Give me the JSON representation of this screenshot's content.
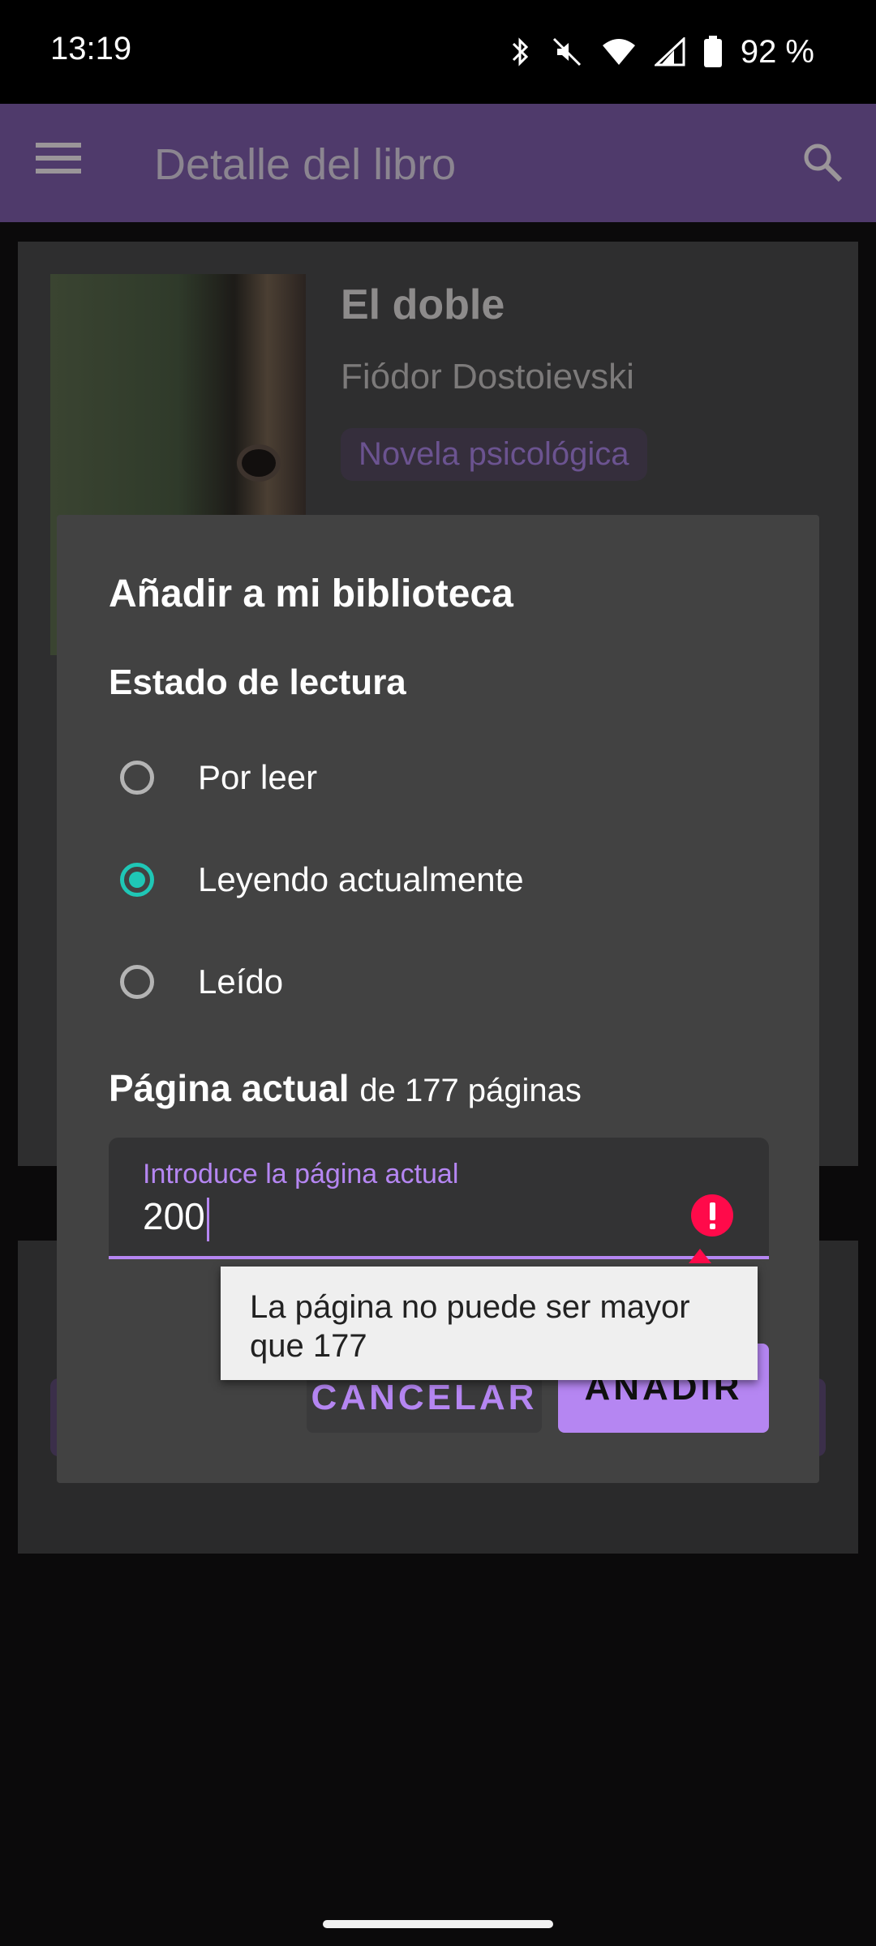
{
  "status_bar": {
    "time": "13:19",
    "battery": "92 %",
    "icons": [
      "bluetooth-icon",
      "mute-icon",
      "wifi-icon",
      "signal-icon",
      "battery-icon"
    ]
  },
  "app_bar": {
    "title": "Detalle del libro",
    "menu_icon": "hamburger-menu-icon",
    "search_icon": "search-icon",
    "color": "#4f3a6b"
  },
  "book": {
    "title": "El doble",
    "author": "Fiódor Dostoievski",
    "genre": "Novela psicológica"
  },
  "dialog": {
    "title": "Añadir a mi biblioteca",
    "section_label": "Estado de lectura",
    "options": [
      {
        "label": "Por leer",
        "selected": false
      },
      {
        "label": "Leyendo actualmente",
        "selected": true
      },
      {
        "label": "Leído",
        "selected": false
      }
    ],
    "page_label": "Página actual",
    "page_suffix": "de 177 páginas",
    "input": {
      "label": "Introduce la página actual",
      "value": "200",
      "error_icon": "error-icon"
    },
    "error_message": "La página no puede ser mayor que 177",
    "cancel_label": "CANCELAR",
    "add_label": "AÑADIR"
  },
  "colors": {
    "accent": "#b586f2",
    "radio_selected": "#1fc7b6",
    "error": "#ff0a4a",
    "dialog_bg": "#424242"
  }
}
